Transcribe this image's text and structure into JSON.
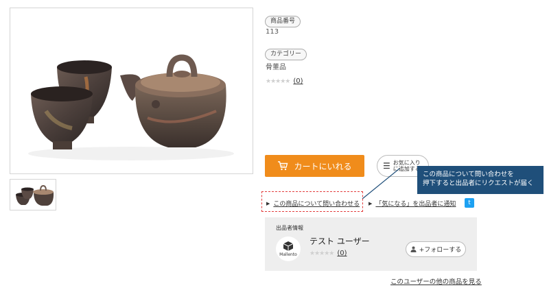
{
  "product": {
    "number_label": "商品番号",
    "number_value": "113",
    "category_label": "カテゴリー",
    "category_value": "骨董品",
    "stars": "★★★★★",
    "rating_count": "(0)"
  },
  "actions": {
    "cart_label": "カートにいれる",
    "favorite_line1": "お気に入り",
    "favorite_line2": "に追加する",
    "inquiry_link": "この商品について問い合わせる",
    "notify_link": "「気になる」を出品者に通知",
    "twitter_glyph": "t"
  },
  "callout": {
    "line1": "この商品について問い合わせを",
    "line2": "押下すると出品者にリクエストが届く"
  },
  "seller": {
    "section_label": "出品者情報",
    "name": "テスト ユーザー",
    "logo_text": "Mallento",
    "stars": "★★★★★",
    "rating_count": "(0)",
    "follow_label": "+フォローする",
    "other_items_link": "このユーザーの他の商品を見る"
  },
  "colors": {
    "cart": "#f08c1b",
    "callout": "#1f4f7a",
    "highlight": "#e23b3b",
    "twitter": "#1da1f2"
  }
}
